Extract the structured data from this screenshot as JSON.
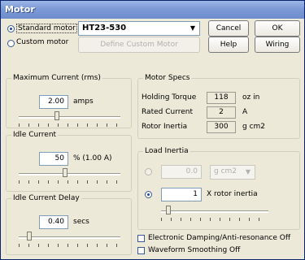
{
  "window": {
    "title": "Motor"
  },
  "motor_type": {
    "standard_label": "Standard motor",
    "standard_selected": true,
    "custom_label": "Custom motor",
    "selected_model": "HT23-530",
    "define_custom_label": "Define Custom Motor"
  },
  "buttons": {
    "cancel": "Cancel",
    "ok": "OK",
    "help": "Help",
    "wiring": "Wiring"
  },
  "max_current": {
    "title": "Maximum Current (rms)",
    "value": "2.00",
    "unit": "amps",
    "slider_fraction": 0.37
  },
  "idle_current": {
    "title": "Idle Current",
    "value": "50",
    "unit": "% (1.00 A)",
    "slider_fraction": 0.45
  },
  "idle_delay": {
    "title": "Idle Current Delay",
    "value": "0.40",
    "unit": "secs",
    "slider_fraction": 0.08
  },
  "motor_specs": {
    "title": "Motor Specs",
    "rows": [
      {
        "label": "Holding Torque",
        "value": "118",
        "unit": "oz in"
      },
      {
        "label": "Rated Current",
        "value": "2",
        "unit": "A"
      },
      {
        "label": "Rotor Inertia",
        "value": "300",
        "unit": "g cm2"
      }
    ]
  },
  "load_inertia": {
    "title": "Load Inertia",
    "absolute_value": "0.0",
    "absolute_unit": "g cm2",
    "ratio_selected": true,
    "ratio_value": "1",
    "ratio_label": "X rotor inertia",
    "slider_fraction": 0.05
  },
  "options": {
    "damping_label": "Electronic Damping/Anti-resonance Off",
    "smoothing_label": "Waveform Smoothing Off"
  }
}
